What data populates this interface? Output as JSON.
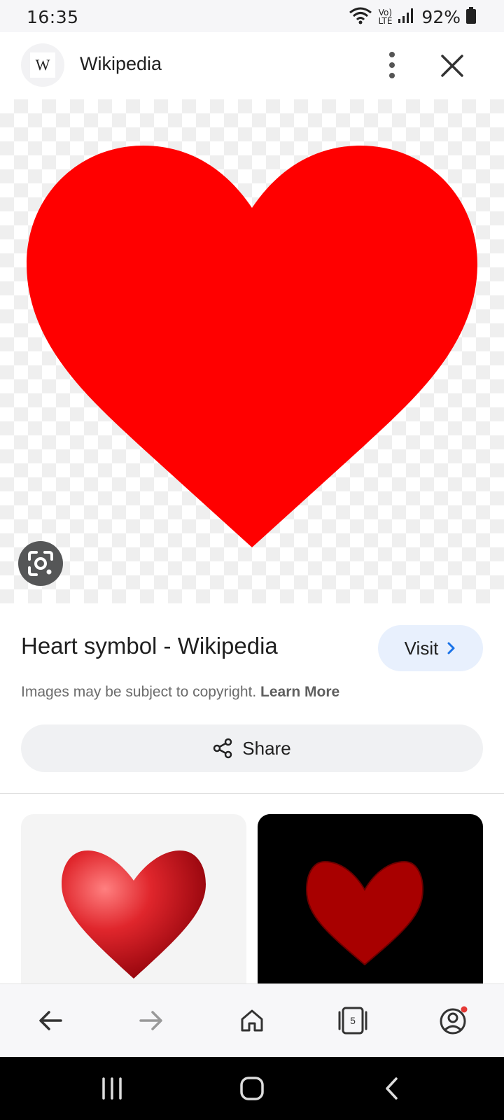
{
  "status_bar": {
    "time": "16:35",
    "battery": "92%",
    "network_label": "VoLTE"
  },
  "header": {
    "site_icon_letter": "W",
    "site_name": "Wikipedia",
    "more_icon": "more-vert-icon",
    "close_icon": "close-icon"
  },
  "image": {
    "heart_color": "#ff0000",
    "lens_icon": "google-lens-icon"
  },
  "result": {
    "title": "Heart symbol - Wikipedia",
    "visit_label": "Visit",
    "copyright_text": "Images may be subject to copyright.",
    "learn_more_label": "Learn More",
    "share_label": "Share"
  },
  "related": {
    "thumb_left_color": "#e0262c",
    "thumb_right_color": "#a80000"
  },
  "bottom_nav": {
    "tab_count": "5",
    "items": [
      "back-icon",
      "forward-icon",
      "home-icon",
      "tabs-icon",
      "account-icon"
    ]
  },
  "system_nav": {
    "items": [
      "recents-icon",
      "home-icon",
      "back-icon"
    ]
  }
}
